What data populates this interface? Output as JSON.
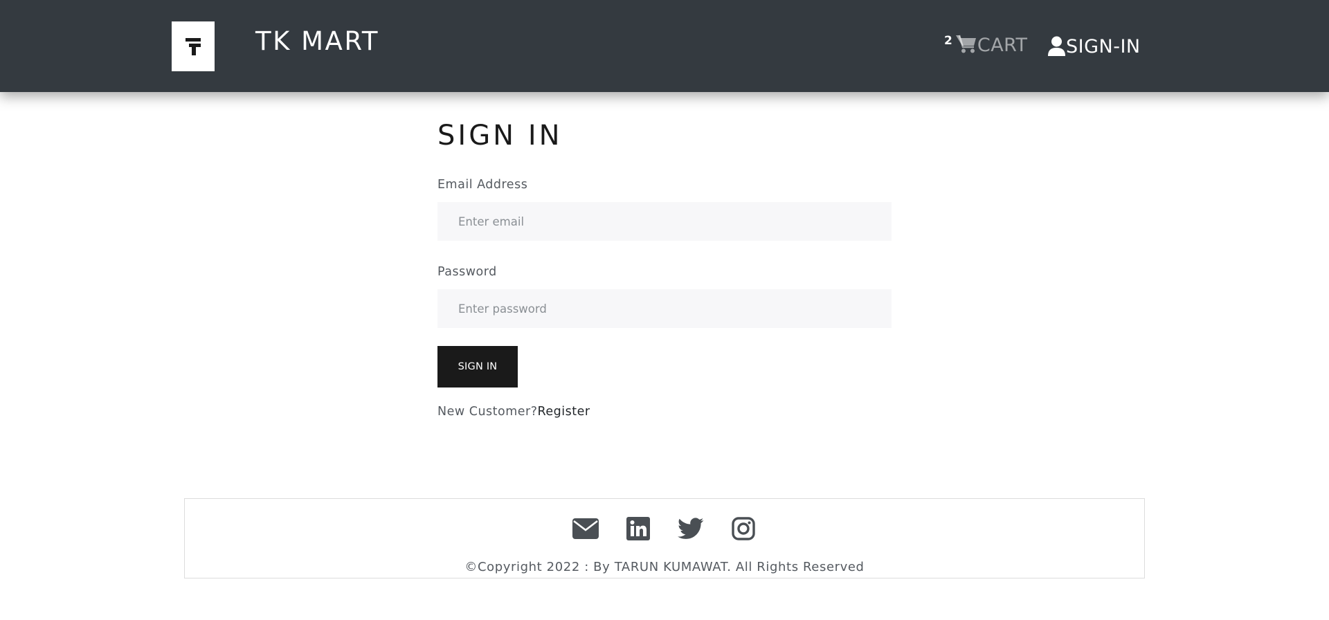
{
  "header": {
    "brand": "TK MART",
    "logo_letter": "T",
    "cart": {
      "count": "2",
      "label": "CART",
      "icon": "cart-icon"
    },
    "signin": {
      "label": "SIGN-IN",
      "icon": "user-icon"
    }
  },
  "form": {
    "title": "SIGN IN",
    "email": {
      "label": "Email Address",
      "placeholder": "Enter email",
      "value": ""
    },
    "password": {
      "label": "Password",
      "placeholder": "Enter password",
      "value": ""
    },
    "submit_label": "SIGN IN",
    "new_customer_text": "New Customer?",
    "register_label": "Register"
  },
  "footer": {
    "icons": [
      "envelope-icon",
      "linkedin-icon",
      "twitter-icon",
      "instagram-icon"
    ],
    "copyright": "©Copyright 2022 : By TARUN KUMAWAT. All Rights Reserved"
  },
  "colors": {
    "navbar_bg": "#343a40",
    "button_bg": "#1a1a1a",
    "input_bg": "#f7f7f9",
    "icon_color": "#4a4f54"
  }
}
